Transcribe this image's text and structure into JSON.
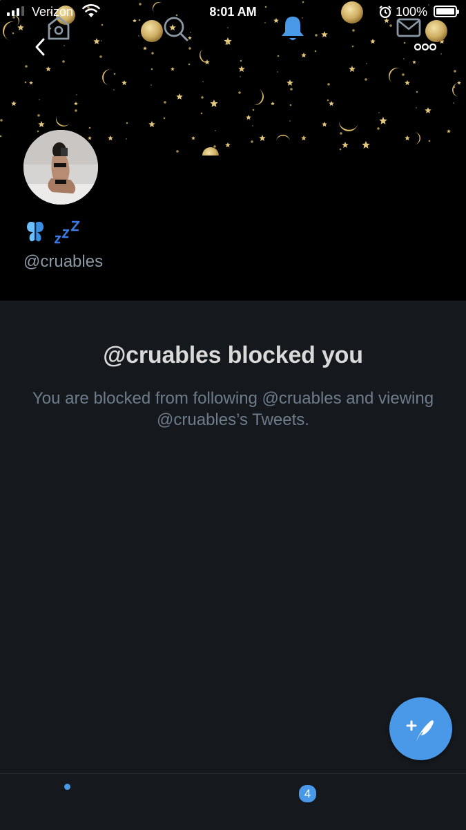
{
  "status_bar": {
    "carrier": "Verizon",
    "time": "8:01 AM",
    "battery": "100%"
  },
  "profile": {
    "display_name_icons": [
      "butterfly-emoji",
      "zzz-emoji"
    ],
    "handle": "@cruables"
  },
  "blocked": {
    "title": "@cruables blocked you",
    "description": "You are blocked from following @cruables and viewing @cruables’s Tweets."
  },
  "tab_bar": {
    "items": [
      {
        "name": "home",
        "icon": "home-icon"
      },
      {
        "name": "search",
        "icon": "search-icon"
      },
      {
        "name": "notifications",
        "icon": "bell-icon"
      },
      {
        "name": "messages",
        "icon": "mail-icon"
      }
    ],
    "notifications_badge": "4"
  },
  "colors": {
    "background": "#15181c",
    "header": "#000000",
    "accent": "#4a99e9",
    "muted_text": "#6e7d8b",
    "handle_text": "#8b98a5"
  }
}
